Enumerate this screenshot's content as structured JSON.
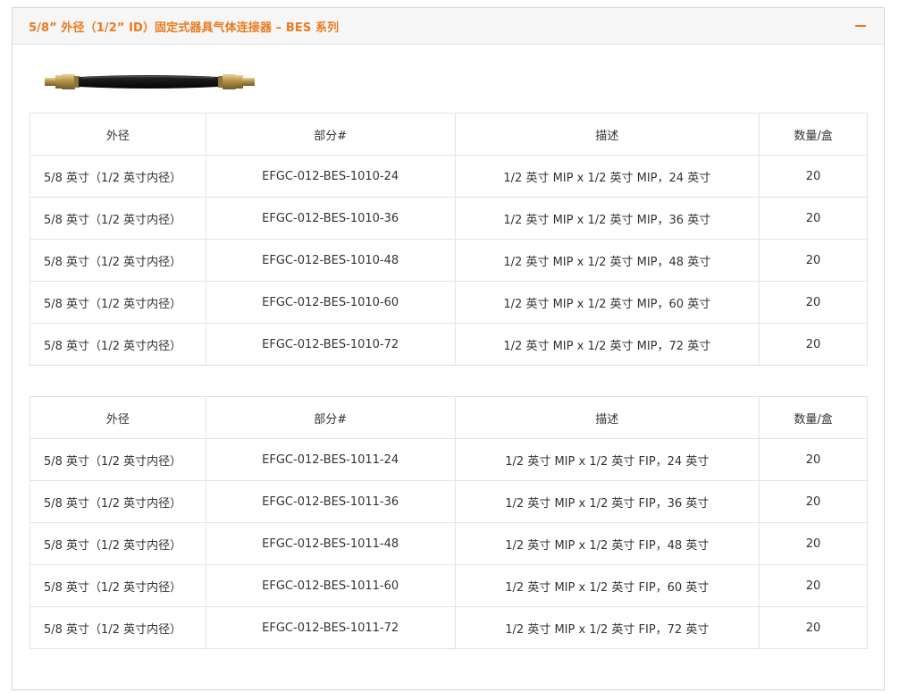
{
  "section": {
    "title": "5/8” 外径（1/2” ID）固定式器具气体连接器 – BES 系列",
    "collapse_icon": "minus-icon",
    "accent_color": "#ea7a1f"
  },
  "product_image": {
    "name": "gas-connector-hose-image"
  },
  "tables": [
    {
      "headers": [
        "外径",
        "部分#",
        "描述",
        "数量/盒"
      ],
      "rows": [
        [
          "5/8 英寸（1/2 英寸内径）",
          "EFGC-012-BES-1010-24",
          "1/2 英寸 MIP x 1/2 英寸 MIP，24 英寸",
          "20"
        ],
        [
          "5/8 英寸（1/2 英寸内径）",
          "EFGC-012-BES-1010-36",
          "1/2 英寸 MIP x 1/2 英寸 MIP，36 英寸",
          "20"
        ],
        [
          "5/8 英寸（1/2 英寸内径）",
          "EFGC-012-BES-1010-48",
          "1/2 英寸 MIP x 1/2 英寸 MIP，48 英寸",
          "20"
        ],
        [
          "5/8 英寸（1/2 英寸内径）",
          "EFGC-012-BES-1010-60",
          "1/2 英寸 MIP x 1/2 英寸 MIP，60 英寸",
          "20"
        ],
        [
          "5/8 英寸（1/2 英寸内径）",
          "EFGC-012-BES-1010-72",
          "1/2 英寸 MIP x 1/2 英寸 MIP，72 英寸",
          "20"
        ]
      ]
    },
    {
      "headers": [
        "外径",
        "部分#",
        "描述",
        "数量/盒"
      ],
      "rows": [
        [
          "5/8 英寸（1/2 英寸内径）",
          "EFGC-012-BES-1011-24",
          "1/2 英寸 MIP x 1/2 英寸 FIP，24 英寸",
          "20"
        ],
        [
          "5/8 英寸（1/2 英寸内径）",
          "EFGC-012-BES-1011-36",
          "1/2 英寸 MIP x 1/2 英寸 FIP，36 英寸",
          "20"
        ],
        [
          "5/8 英寸（1/2 英寸内径）",
          "EFGC-012-BES-1011-48",
          "1/2 英寸 MIP x 1/2 英寸 FIP，48 英寸",
          "20"
        ],
        [
          "5/8 英寸（1/2 英寸内径）",
          "EFGC-012-BES-1011-60",
          "1/2 英寸 MIP x 1/2 英寸 FIP，60 英寸",
          "20"
        ],
        [
          "5/8 英寸（1/2 英寸内径）",
          "EFGC-012-BES-1011-72",
          "1/2 英寸 MIP x 1/2 英寸 FIP，72 英寸",
          "20"
        ]
      ]
    }
  ]
}
